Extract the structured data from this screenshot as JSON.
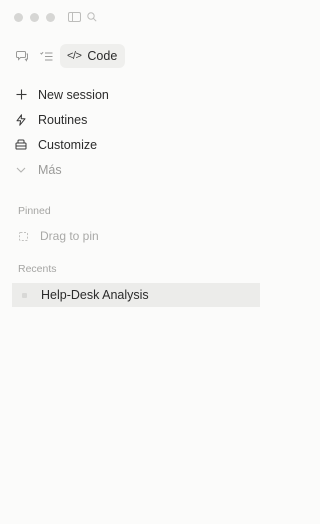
{
  "titlebar": {
    "traffic_lights": [
      "close",
      "minimize",
      "zoom"
    ],
    "icons": [
      "sidebar-toggle-icon",
      "search-icon"
    ]
  },
  "modes": {
    "chat_icon": "chat-bubble-icon",
    "tasks_icon": "checklist-icon",
    "code_label": "Code"
  },
  "nav": {
    "items": [
      {
        "label": "New session",
        "icon": "plus-icon"
      },
      {
        "label": "Routines",
        "icon": "routines-icon"
      },
      {
        "label": "Customize",
        "icon": "customize-icon"
      },
      {
        "label": "Más",
        "icon": "chevron-down-icon"
      }
    ]
  },
  "sections": {
    "pinned_label": "Pinned",
    "pinned_placeholder": "Drag to pin",
    "recents_label": "Recents"
  },
  "recents": [
    {
      "title": "Help-Desk Analysis"
    }
  ]
}
